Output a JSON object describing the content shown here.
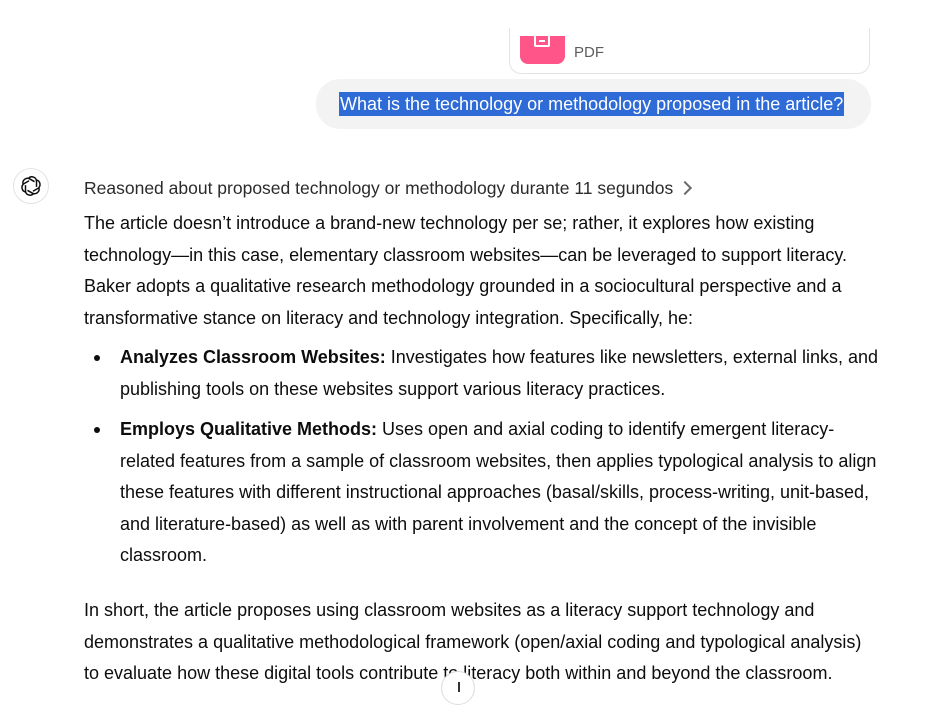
{
  "attachment": {
    "type_label": "PDF",
    "icon": "document-icon"
  },
  "user_message": "What is the technology or methodology proposed in the article?",
  "assistant": {
    "avatar_icon": "openai-logo-icon",
    "reasoning_label": "Reasoned about proposed technology or methodology durante 11 segundos",
    "intro_lines": [
      "The article doesn’t introduce a brand-new technology per se; rather, it explores how existing",
      "technology—in this case, elementary classroom websites—can be leveraged to support literacy.",
      "Baker adopts a qualitative research methodology grounded in a sociocultural perspective and a",
      "transformative stance on literacy and technology integration. Specifically, he:"
    ],
    "bullets": [
      {
        "title": "Analyzes Classroom Websites:",
        "lines": [
          " Investigates how features like newsletters, external links, and",
          "publishing tools on these websites support various literacy practices."
        ]
      },
      {
        "title": "Employs Qualitative Methods:",
        "lines": [
          " Uses open and axial coding to identify emergent literacy-",
          "related features from a sample of classroom websites, then applies typological analysis to align",
          "these features with different instructional approaches (basal/skills, process-writing, unit-based,",
          "and literature-based) as well as with parent involvement and the concept of the invisible",
          "classroom."
        ]
      }
    ],
    "summary_lines": [
      "In short, the article proposes using classroom websites as a literacy support technology and",
      "demonstrates a qualitative methodological framework (open/axial coding and typological analysis)",
      "to evaluate how these digital tools contribute to literacy both within and beyond the classroom."
    ]
  },
  "colors": {
    "selection": "#2f6bd6",
    "bubble": "#f3f3f3",
    "pdf_icon": "#ff5588"
  }
}
